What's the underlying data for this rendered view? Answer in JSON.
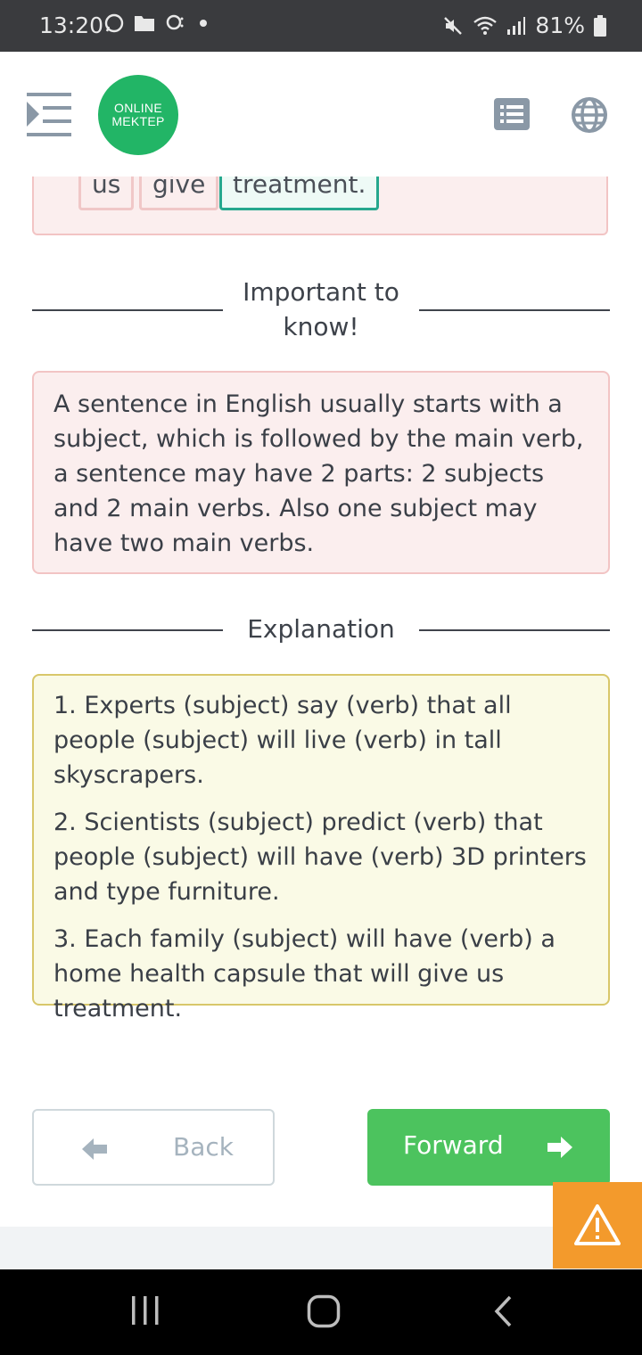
{
  "status_bar": {
    "time": "13:20",
    "battery": "81%",
    "left_icons": [
      "whatsapp-icon",
      "folder-icon",
      "weather-icon",
      "dot-icon"
    ],
    "right_icons": [
      "mute-icon",
      "wifi-icon",
      "signal-icon",
      "battery-icon"
    ]
  },
  "header": {
    "logo_line1": "ONLINE",
    "logo_line2": "MEKTEP",
    "menu_icon": "menu-indent-icon",
    "list_icon": "list-icon",
    "globe_icon": "globe-icon"
  },
  "answer": {
    "chips": [
      {
        "text": "us",
        "state": "neutral"
      },
      {
        "text": "give",
        "state": "neutral"
      },
      {
        "text": "treatment.",
        "state": "correct"
      }
    ]
  },
  "important": {
    "title": "Important to know!",
    "body": "A sentence in English usually starts with a subject, which is followed by the main verb, a sentence may have 2 parts: 2 subjects and 2 main verbs. Also one subject may have two main verbs."
  },
  "explanation": {
    "title": "Explanation",
    "items": [
      "1. Experts (subject) say (verb) that all people (subject) will live (verb) in tall skyscrapers.",
      "2. Scientists (subject) predict (verb) that people (subject) will have (verb) 3D printers and type furniture.",
      "3. Each family (subject) will have (verb) a home health capsule that will give us treatment."
    ]
  },
  "navigation": {
    "back_label": "Back",
    "forward_label": "Forward"
  },
  "colors": {
    "brand_green": "#22b566",
    "forward_green": "#4cc35e",
    "warning_orange": "#f39a2c",
    "correct_teal": "#26a88e"
  }
}
